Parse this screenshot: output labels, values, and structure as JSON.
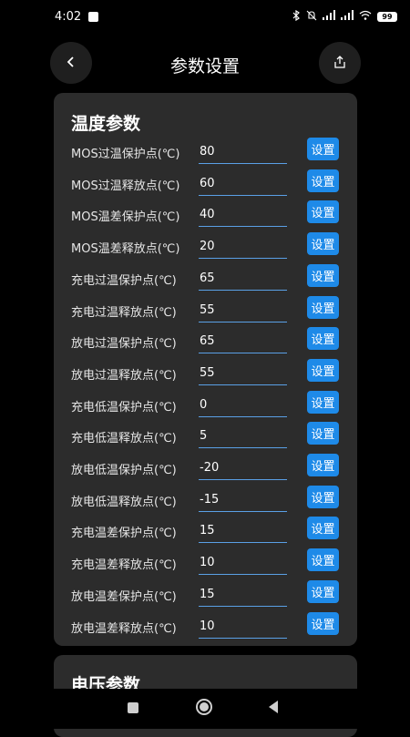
{
  "status_bar": {
    "time": "4:02",
    "battery": "99"
  },
  "header": {
    "title": "参数设置",
    "back_icon": "chevron-left-icon",
    "share_icon": "share-icon"
  },
  "temperature_section": {
    "title": "温度参数",
    "button_label": "设置",
    "rows": [
      {
        "label": "MOS过温保护点(℃)",
        "value": "80"
      },
      {
        "label": "MOS过温释放点(℃)",
        "value": "60"
      },
      {
        "label": "MOS温差保护点(℃)",
        "value": "40"
      },
      {
        "label": "MOS温差释放点(℃)",
        "value": "20"
      },
      {
        "label": "充电过温保护点(℃)",
        "value": "65"
      },
      {
        "label": "充电过温释放点(℃)",
        "value": "55"
      },
      {
        "label": "放电过温保护点(℃)",
        "value": "65"
      },
      {
        "label": "放电过温释放点(℃)",
        "value": "55"
      },
      {
        "label": "充电低温保护点(℃)",
        "value": "0"
      },
      {
        "label": "充电低温释放点(℃)",
        "value": "5"
      },
      {
        "label": "放电低温保护点(℃)",
        "value": "-20"
      },
      {
        "label": "放电低温释放点(℃)",
        "value": "-15"
      },
      {
        "label": "充电温差保护点(℃)",
        "value": "15"
      },
      {
        "label": "充电温差释放点(℃)",
        "value": "10"
      },
      {
        "label": "放电温差保护点(℃)",
        "value": "15"
      },
      {
        "label": "放电温差释放点(℃)",
        "value": "10"
      }
    ]
  },
  "voltage_section": {
    "title": "电压参数"
  },
  "colors": {
    "background": "#000000",
    "card": "#2c2c2c",
    "button": "#1e8ae8",
    "input_underline": "#5aa0e6"
  }
}
